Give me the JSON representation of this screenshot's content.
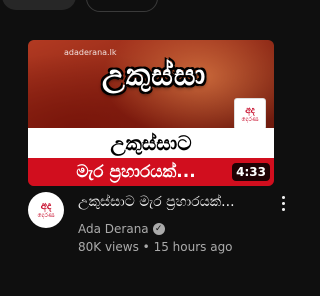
{
  "video": {
    "thumbnail": {
      "watermark": "adaderana.lk",
      "headline": "උකුස්සා",
      "logo_line1": "අද",
      "logo_line2": "දෙරණ",
      "band_white": "උකුස්සාට",
      "band_red": "මැර ප්‍රහාරයක්...",
      "duration": "4:33"
    },
    "title": "උකුස්සාට මැර ප්‍රහාරයක්...",
    "channel": "Ada Derana",
    "verified_glyph": "✓",
    "views": "80K views",
    "separator": "•",
    "uploaded": "15 hours ago",
    "avatar_line1": "අද",
    "avatar_line2": "දෙරණ"
  },
  "colors": {
    "background": "#0f0f0f",
    "text_primary": "#f1f1f1",
    "text_secondary": "#aaaaaa",
    "brand_red": "#d10e1e"
  },
  "icons": {
    "more": "more-vert-icon",
    "verified": "verified-check-icon"
  }
}
